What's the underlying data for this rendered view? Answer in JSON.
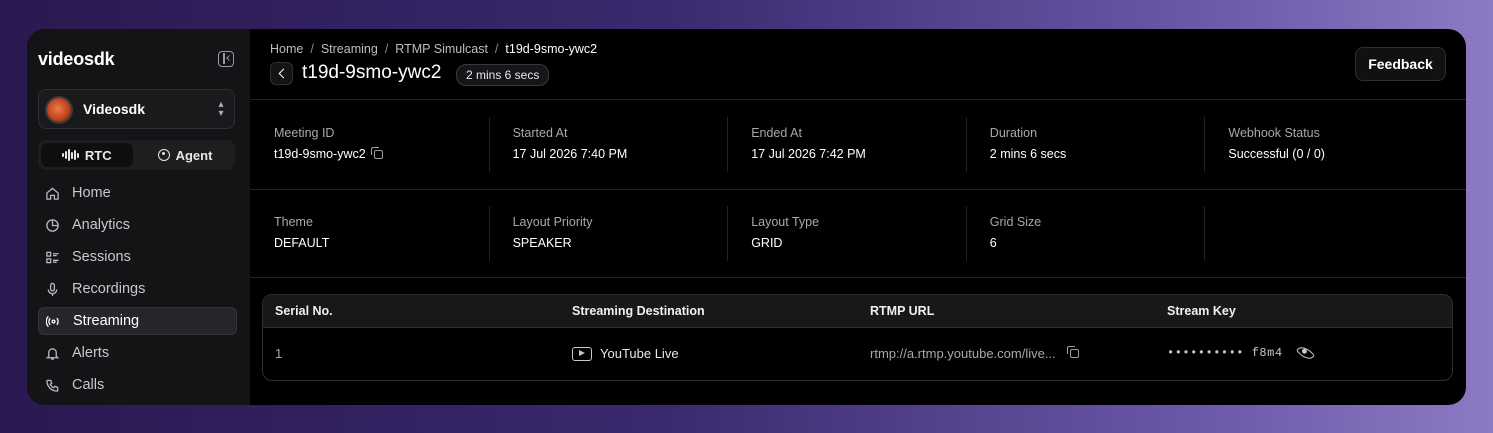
{
  "sidebar": {
    "brand": "videosdk",
    "org_name": "Videosdk",
    "mode": {
      "rtc": "RTC",
      "agent": "Agent",
      "selected": "RTC"
    },
    "items": [
      {
        "label": "Home",
        "icon": "home-icon"
      },
      {
        "label": "Analytics",
        "icon": "pie-chart-icon"
      },
      {
        "label": "Sessions",
        "icon": "list-icon"
      },
      {
        "label": "Recordings",
        "icon": "microphone-icon"
      },
      {
        "label": "Streaming",
        "icon": "broadcast-icon",
        "active": true
      },
      {
        "label": "Alerts",
        "icon": "bell-icon"
      },
      {
        "label": "Calls",
        "icon": "phone-icon"
      }
    ]
  },
  "header": {
    "breadcrumb": [
      "Home",
      "Streaming",
      "RTMP Simulcast",
      "t19d-9smo-ywc2"
    ],
    "title": "t19d-9smo-ywc2",
    "duration_badge": "2 mins 6 secs",
    "feedback_label": "Feedback"
  },
  "details": {
    "row1": [
      {
        "label": "Meeting ID",
        "value": "t19d-9smo-ywc2"
      },
      {
        "label": "Started At",
        "value": "17 Jul 2026 7:40 PM"
      },
      {
        "label": "Ended At",
        "value": "17 Jul 2026 7:42 PM"
      },
      {
        "label": "Duration",
        "value": "2 mins 6 secs"
      },
      {
        "label": "Webhook Status",
        "value": "Successful (0 / 0)"
      }
    ],
    "row2": [
      {
        "label": "Theme",
        "value": "DEFAULT"
      },
      {
        "label": "Layout Priority",
        "value": "SPEAKER"
      },
      {
        "label": "Layout Type",
        "value": "GRID"
      },
      {
        "label": "Grid Size",
        "value": "6"
      }
    ]
  },
  "table": {
    "columns": [
      "Serial No.",
      "Streaming Destination",
      "RTMP URL",
      "Stream Key"
    ],
    "rows": [
      {
        "serial": "1",
        "destination": "YouTube Live",
        "rtmp_url": "rtmp://a.rtmp.youtube.com/live...",
        "stream_key": "•••••••••• f8m4"
      }
    ]
  },
  "colors": {
    "background": "#000000",
    "sidebar": "#141416",
    "accent_gradient_start": "#2a1850",
    "accent_gradient_end": "#8c7ac4"
  }
}
